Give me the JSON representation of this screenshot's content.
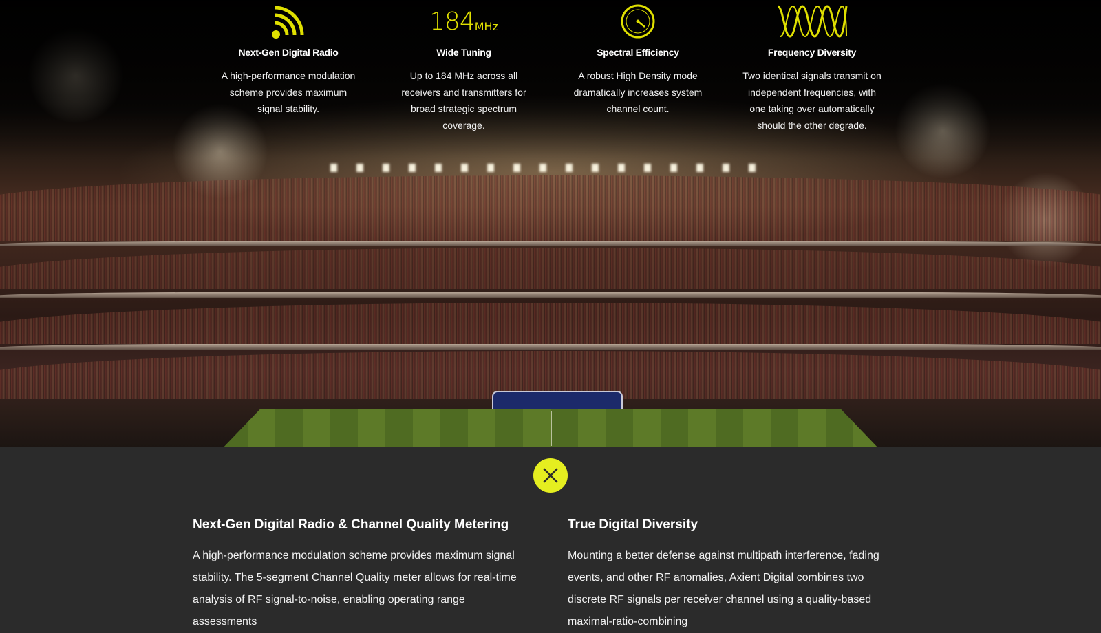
{
  "features": [
    {
      "icon": "radio-waves-icon",
      "title": "Next-Gen Digital Radio",
      "description": "A high-performance modulation scheme provides maximum signal stability."
    },
    {
      "icon": "frequency-readout",
      "value": "184",
      "unit": "MHz",
      "title": "Wide Tuning",
      "description": "Up to 184 MHz across all receivers and transmitters for broad strategic spectrum coverage."
    },
    {
      "icon": "gauge-icon",
      "title": "Spectral Efficiency",
      "description": "A robust High Density mode dramatically increases system channel count."
    },
    {
      "icon": "dual-wave-icon",
      "title": "Frequency Diversity",
      "description": "Two identical signals transmit on independent frequencies, with one taking over automatically should the other degrade."
    }
  ],
  "close_button": {
    "icon": "close-icon"
  },
  "details": [
    {
      "heading": "Next-Gen Digital Radio & Channel Quality Metering",
      "body": "A high-performance modulation scheme provides maximum signal stability. The 5-segment Channel Quality meter allows for real-time analysis of RF signal-to-noise, enabling operating range assessments"
    },
    {
      "heading": "True Digital Diversity",
      "body": "Mounting a better defense against multipath interference, fading events, and other RF anomalies, Axient Digital combines two discrete RF signals per receiver channel using a quality-based maximal-ratio-combining"
    }
  ],
  "colors": {
    "accent": "#e5ee20",
    "icon_yellow": "#e0e000",
    "panel_background": "#2b2b2b"
  }
}
